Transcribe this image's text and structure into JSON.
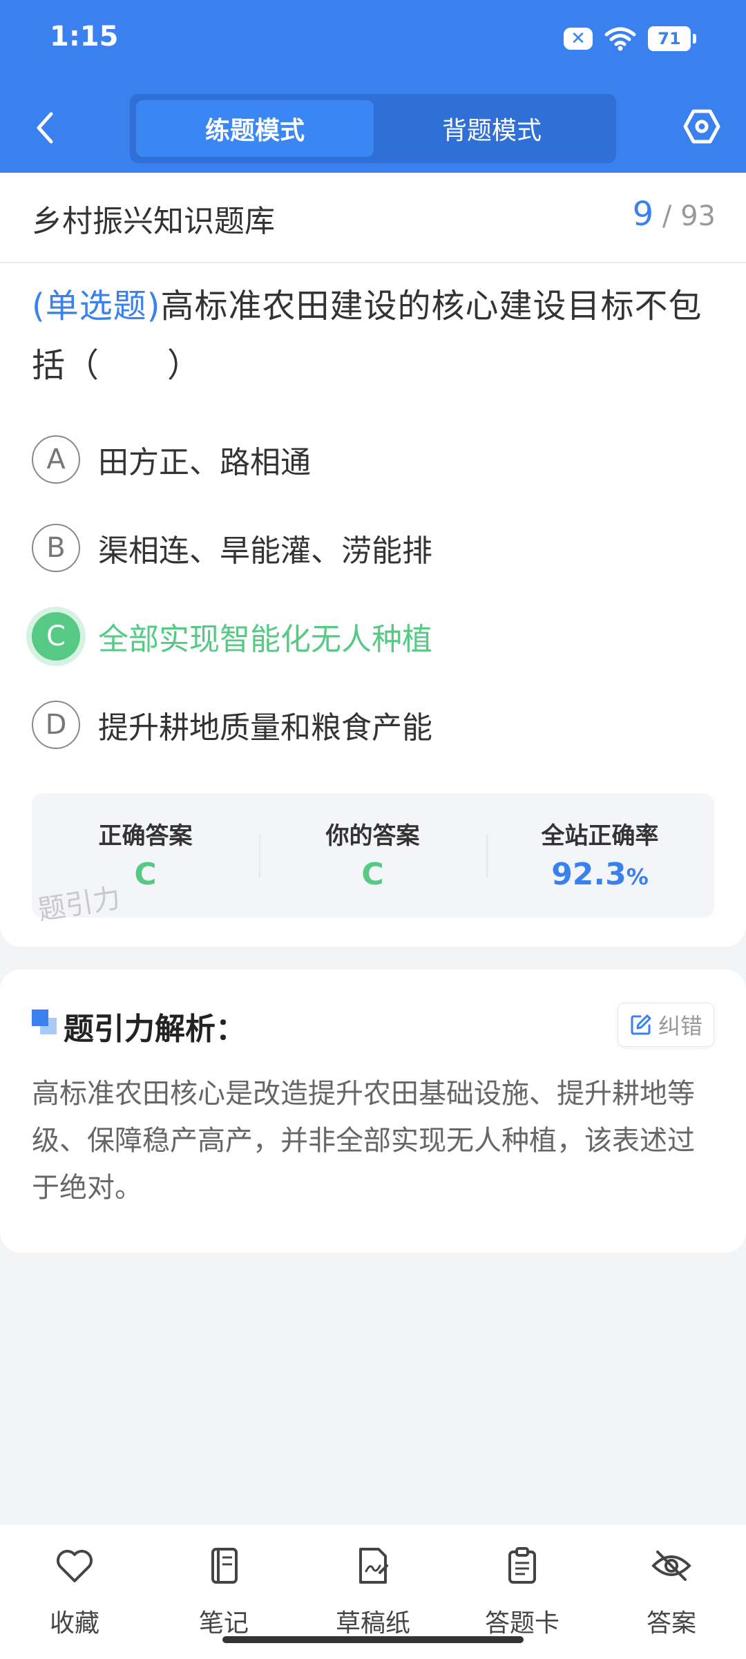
{
  "status_bar": {
    "time": "1:15",
    "battery": "71"
  },
  "header": {
    "tabs": [
      {
        "label": "练题模式",
        "active": true
      },
      {
        "label": "背题模式",
        "active": false
      }
    ]
  },
  "question_bank": {
    "title": "乡村振兴知识题库",
    "current": "9",
    "separator": "/",
    "total": "93"
  },
  "question": {
    "type": "(单选题)",
    "text": "高标准农田建设的核心建设目标不包括（　　）",
    "options": [
      {
        "letter": "A",
        "text": "田方正、路相通"
      },
      {
        "letter": "B",
        "text": "渠相连、旱能灌、涝能排"
      },
      {
        "letter": "C",
        "text": "全部实现智能化无人种植",
        "selected_correct": true
      },
      {
        "letter": "D",
        "text": "提升耕地质量和粮食产能"
      }
    ]
  },
  "answer_summary": {
    "correct_label": "正确答案",
    "correct_value": "C",
    "yours_label": "你的答案",
    "yours_value": "C",
    "rate_label": "全站正确率",
    "rate_value": "92.3",
    "rate_unit": "%",
    "watermark": "题引力"
  },
  "analysis": {
    "title": "题引力解析：",
    "report_label": "纠错",
    "text": "高标准农田核心是改造提升农田基础设施、提升耕地等级、保障稳产高产，并非全部实现无人种植，该表述过于绝对。"
  },
  "bottom_nav": [
    {
      "label": "收藏",
      "icon": "heart-icon"
    },
    {
      "label": "笔记",
      "icon": "notebook-icon"
    },
    {
      "label": "草稿纸",
      "icon": "draft-paper-icon"
    },
    {
      "label": "答题卡",
      "icon": "answer-sheet-icon"
    },
    {
      "label": "答案",
      "icon": "eye-off-icon"
    }
  ],
  "colors": {
    "primary": "#3a80ee",
    "correct": "#56c985",
    "background": "#f3f4f6"
  }
}
